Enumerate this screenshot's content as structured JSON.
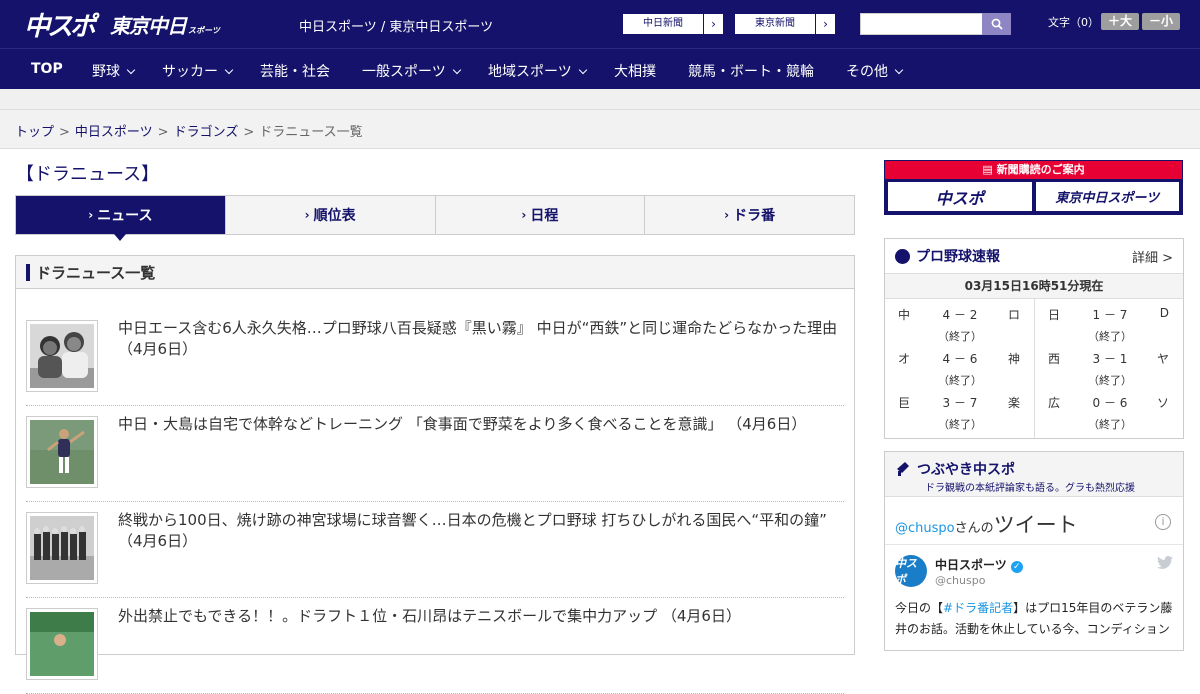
{
  "header": {
    "logo_chuspo": "中スポ",
    "logo_tokyo": "東京中日",
    "logo_tokyo_sub": "スポーツ",
    "site_title": "中日スポーツ / 東京中日スポーツ",
    "link_chunichi": "中日新聞",
    "link_tokyo": "東京新聞",
    "search_placeholder": "",
    "font_label": "文字（0）",
    "font_larger": "＋大",
    "font_smaller": "－小"
  },
  "nav": {
    "items": [
      {
        "label": "TOP"
      },
      {
        "label": "野球"
      },
      {
        "label": "サッカー"
      },
      {
        "label": "芸能・社会"
      },
      {
        "label": "一般スポーツ"
      },
      {
        "label": "地域スポーツ"
      },
      {
        "label": "大相撲"
      },
      {
        "label": "競馬・ボート・競輪"
      },
      {
        "label": "その他"
      }
    ]
  },
  "breadcrumb": {
    "items": [
      "トップ",
      "中日スポーツ",
      "ドラゴンズ"
    ],
    "current": "ドラニュース一覧",
    "separator": ">"
  },
  "page_title": "【ドラニュース】",
  "tabs": [
    {
      "label": "ニュース",
      "active": true
    },
    {
      "label": "順位表",
      "active": false
    },
    {
      "label": "日程",
      "active": false
    },
    {
      "label": "ドラ番",
      "active": false
    }
  ],
  "tab_marker": "›",
  "list": {
    "heading": "ドラニュース一覧",
    "articles": [
      {
        "title": "中日エース含む6人永久失格…プロ野球八百長疑惑『黒い霧』 中日が“西鉄”と同じ運命たどらなかった理由 （4月6日）"
      },
      {
        "title": "中日・大島は自宅で体幹などトレーニング 「食事面で野菜をより多く食べることを意識」 （4月6日）"
      },
      {
        "title": "終戦から100日、焼け跡の神宮球場に球音響く…日本の危機とプロ野球 打ちひしがれる国民へ“平和の鐘” （4月6日）"
      },
      {
        "title": "外出禁止でもできる！！。ドラフト１位・石川昂はテニスボールで集中力アップ （4月6日）"
      }
    ]
  },
  "sidebar": {
    "subscribe": {
      "heading": "新聞購読のご案内",
      "chuspo": "中スポ",
      "tokyo": "東京中日スポーツ"
    },
    "scores": {
      "title": "プロ野球速報",
      "more": "詳細 >",
      "timestamp": "03月15日16時51分現在",
      "games_left": [
        {
          "home": "中",
          "score": "4 － 2",
          "away": "ロ",
          "status": "（終了）"
        },
        {
          "home": "オ",
          "score": "4 － 6",
          "away": "神",
          "status": "（終了）"
        },
        {
          "home": "巨",
          "score": "3 － 7",
          "away": "楽",
          "status": "（終了）"
        }
      ],
      "games_right": [
        {
          "home": "日",
          "score": "1 － 7",
          "away": "D",
          "status": "（終了）"
        },
        {
          "home": "西",
          "score": "3 － 1",
          "away": "ヤ",
          "status": "（終了）"
        },
        {
          "home": "広",
          "score": "0 － 6",
          "away": "ソ",
          "status": "（終了）"
        }
      ]
    },
    "tweets": {
      "title": "つぶやき中スポ",
      "subtitle": "ドラ観戦の本紙評論家も語る。グラも熱烈応援",
      "handle_prefix": "@chuspo",
      "handle_suffix": "さんの",
      "tweet_word": "ツイート",
      "avatar_text": "中スポ",
      "account_name": "中日スポーツ",
      "account_handle": "@chuspo",
      "text_before": "今日の【",
      "hashtag": "#ドラ番記者",
      "text_after": "】はプロ15年目のベテラン藤井のお話。活動を休止している今、コンディション"
    }
  },
  "colors": {
    "brand_navy": "#14126a",
    "accent_red": "#e60033",
    "twitter_blue": "#1da1f2"
  }
}
